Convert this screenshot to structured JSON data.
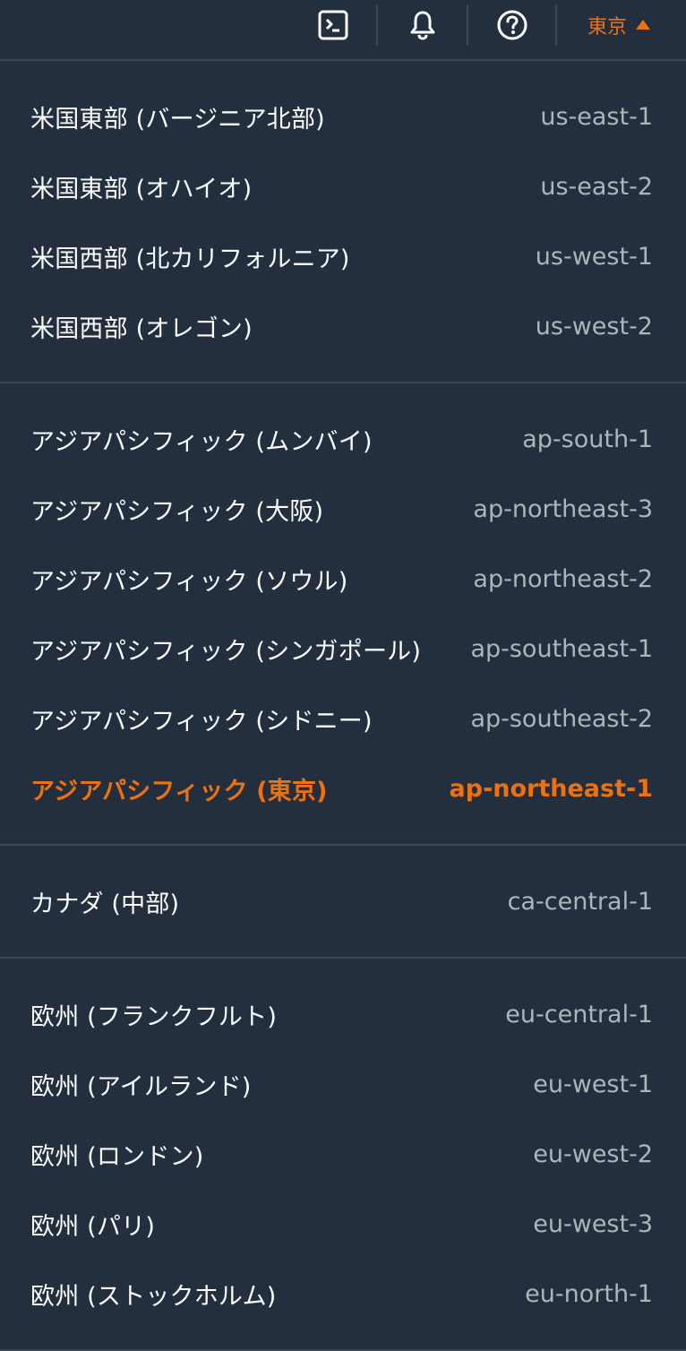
{
  "topbar": {
    "icons": [
      "cloudshell-icon",
      "bell-icon",
      "help-icon"
    ],
    "region_label": "東京"
  },
  "colors": {
    "background": "#232f3e",
    "accent": "#ec7211",
    "code_text": "#aab7b8",
    "divider": "#3b4757"
  },
  "groups": [
    {
      "regions": [
        {
          "name": "米国東部 (バージニア北部)",
          "code": "us-east-1"
        },
        {
          "name": "米国東部 (オハイオ)",
          "code": "us-east-2"
        },
        {
          "name": "米国西部 (北カリフォルニア)",
          "code": "us-west-1"
        },
        {
          "name": "米国西部 (オレゴン)",
          "code": "us-west-2"
        }
      ]
    },
    {
      "regions": [
        {
          "name": "アジアパシフィック (ムンバイ)",
          "code": "ap-south-1"
        },
        {
          "name": "アジアパシフィック (大阪)",
          "code": "ap-northeast-3"
        },
        {
          "name": "アジアパシフィック (ソウル)",
          "code": "ap-northeast-2"
        },
        {
          "name": "アジアパシフィック (シンガポール)",
          "code": "ap-southeast-1"
        },
        {
          "name": "アジアパシフィック (シドニー)",
          "code": "ap-southeast-2"
        },
        {
          "name": "アジアパシフィック (東京)",
          "code": "ap-northeast-1",
          "selected": true
        }
      ]
    },
    {
      "regions": [
        {
          "name": "カナダ (中部)",
          "code": "ca-central-1"
        }
      ]
    },
    {
      "regions": [
        {
          "name": "欧州 (フランクフルト)",
          "code": "eu-central-1"
        },
        {
          "name": "欧州 (アイルランド)",
          "code": "eu-west-1"
        },
        {
          "name": "欧州 (ロンドン)",
          "code": "eu-west-2"
        },
        {
          "name": "欧州 (パリ)",
          "code": "eu-west-3"
        },
        {
          "name": "欧州 (ストックホルム)",
          "code": "eu-north-1"
        }
      ]
    }
  ]
}
